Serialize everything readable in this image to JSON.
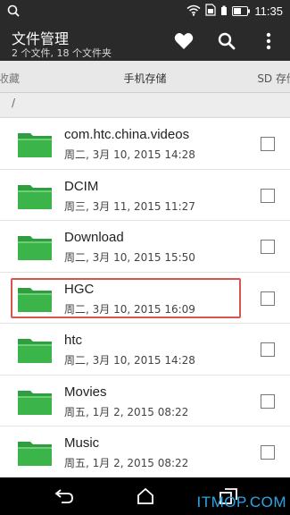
{
  "status_bar": {
    "clock": "11:35",
    "icons": [
      "search-icon",
      "wifi-icon",
      "sim-icon",
      "data-icon",
      "battery-icon"
    ]
  },
  "action_bar": {
    "title": "文件管理",
    "subtitle": "2 个文件, 18 个文件夹",
    "actions": [
      "favorite-heart-icon",
      "search-icon",
      "overflow-menu-icon"
    ]
  },
  "tabs": {
    "previous": "收藏",
    "current": "手机存储",
    "next": "SD 存储"
  },
  "path": "/",
  "files": [
    {
      "name": "com.htc.china.videos",
      "date": "周二, 3月 10, 2015 14:28",
      "checked": false
    },
    {
      "name": "DCIM",
      "date": "周三, 3月 11, 2015 11:27",
      "checked": false
    },
    {
      "name": "Download",
      "date": "周二, 3月 10, 2015 15:50",
      "checked": false
    },
    {
      "name": "HGC",
      "date": "周二, 3月 10, 2015 16:09",
      "checked": false,
      "highlighted": true
    },
    {
      "name": "htc",
      "date": "周二, 3月 10, 2015 14:28",
      "checked": false
    },
    {
      "name": "Movies",
      "date": "周五, 1月 2, 2015 08:22",
      "checked": false
    },
    {
      "name": "Music",
      "date": "周五, 1月 2, 2015 08:22",
      "checked": false
    }
  ],
  "nav": [
    "back-icon",
    "home-icon",
    "recent-apps-icon"
  ],
  "watermark": "ITMOP.COM",
  "colors": {
    "bar": "#2a2a2a",
    "folder_green": "#3bb54a",
    "highlight_red": "#d9534f",
    "watermark_blue": "#2ba6e4"
  }
}
